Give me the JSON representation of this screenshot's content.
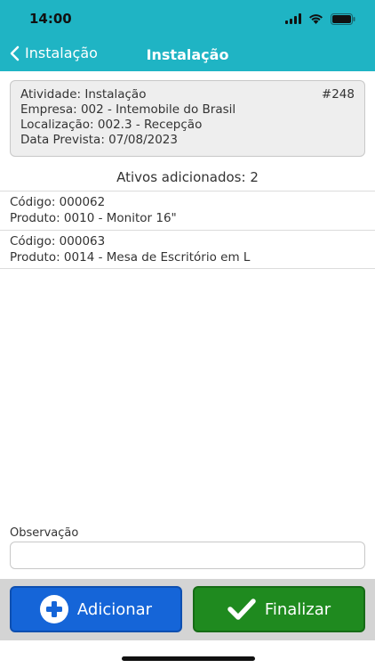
{
  "status_bar": {
    "time": "14:00"
  },
  "nav": {
    "back_label": "Instalação",
    "title": "Instalação"
  },
  "activity": {
    "activity": "Atividade: Instalação",
    "number": "#248",
    "company": "Empresa: 002 - Intemobile do Brasil",
    "location": "Localização: 002.3 - Recepção",
    "due_date": "Data Prevista: 07/08/2023"
  },
  "assets": {
    "title": "Ativos adicionados: 2",
    "items": [
      {
        "code": "Código: 000062",
        "product": "Produto: 0010 - Monitor 16\""
      },
      {
        "code": "Código: 000063",
        "product": "Produto: 0014 - Mesa de Escritório em L"
      }
    ]
  },
  "observation": {
    "label": "Observação",
    "value": "",
    "placeholder": ""
  },
  "actions": {
    "add_label": "Adicionar",
    "finish_label": "Finalizar"
  },
  "colors": {
    "header": "#1fb4c4",
    "add_button": "#1565d8",
    "finish_button": "#1f8a1f"
  },
  "icons": {
    "back": "chevron-left-icon",
    "add": "plus-circle-icon",
    "finish": "checkmark-icon"
  }
}
